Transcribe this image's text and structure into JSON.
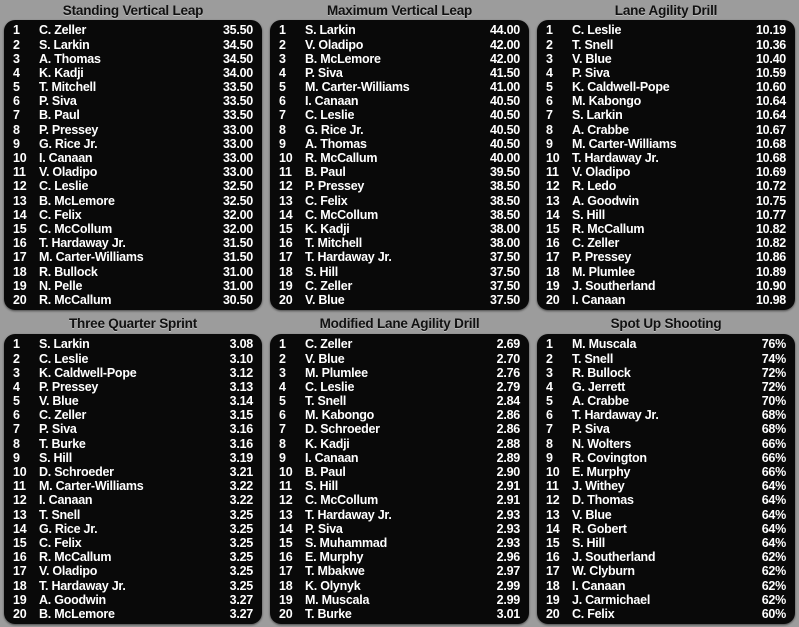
{
  "colors": {
    "background": "#9c9c9c",
    "panel": "#090909",
    "title_text": "#111111",
    "row_text": "#ffffff"
  },
  "panels": [
    {
      "title": "Standing Vertical Leap",
      "rows": [
        {
          "rank": "1",
          "name": "C. Zeller",
          "value": "35.50"
        },
        {
          "rank": "2",
          "name": "S. Larkin",
          "value": "34.50"
        },
        {
          "rank": "3",
          "name": "A. Thomas",
          "value": "34.50"
        },
        {
          "rank": "4",
          "name": "K. Kadji",
          "value": "34.00"
        },
        {
          "rank": "5",
          "name": "T. Mitchell",
          "value": "33.50"
        },
        {
          "rank": "6",
          "name": "P. Siva",
          "value": "33.50"
        },
        {
          "rank": "7",
          "name": "B. Paul",
          "value": "33.50"
        },
        {
          "rank": "8",
          "name": "P. Pressey",
          "value": "33.00"
        },
        {
          "rank": "9",
          "name": "G. Rice Jr.",
          "value": "33.00"
        },
        {
          "rank": "10",
          "name": "I. Canaan",
          "value": "33.00"
        },
        {
          "rank": "11",
          "name": "V. Oladipo",
          "value": "33.00"
        },
        {
          "rank": "12",
          "name": "C. Leslie",
          "value": "32.50"
        },
        {
          "rank": "13",
          "name": "B. McLemore",
          "value": "32.50"
        },
        {
          "rank": "14",
          "name": "C. Felix",
          "value": "32.00"
        },
        {
          "rank": "15",
          "name": "C. McCollum",
          "value": "32.00"
        },
        {
          "rank": "16",
          "name": "T. Hardaway Jr.",
          "value": "31.50"
        },
        {
          "rank": "17",
          "name": "M. Carter-Williams",
          "value": "31.50"
        },
        {
          "rank": "18",
          "name": "R. Bullock",
          "value": "31.00"
        },
        {
          "rank": "19",
          "name": "N. Pelle",
          "value": "31.00"
        },
        {
          "rank": "20",
          "name": "R. McCallum",
          "value": "30.50"
        }
      ]
    },
    {
      "title": "Maximum Vertical Leap",
      "rows": [
        {
          "rank": "1",
          "name": "S. Larkin",
          "value": "44.00"
        },
        {
          "rank": "2",
          "name": "V. Oladipo",
          "value": "42.00"
        },
        {
          "rank": "3",
          "name": "B. McLemore",
          "value": "42.00"
        },
        {
          "rank": "4",
          "name": "P. Siva",
          "value": "41.50"
        },
        {
          "rank": "5",
          "name": "M. Carter-Williams",
          "value": "41.00"
        },
        {
          "rank": "6",
          "name": "I. Canaan",
          "value": "40.50"
        },
        {
          "rank": "7",
          "name": "C. Leslie",
          "value": "40.50"
        },
        {
          "rank": "8",
          "name": "G. Rice Jr.",
          "value": "40.50"
        },
        {
          "rank": "9",
          "name": "A. Thomas",
          "value": "40.50"
        },
        {
          "rank": "10",
          "name": "R. McCallum",
          "value": "40.00"
        },
        {
          "rank": "11",
          "name": "B. Paul",
          "value": "39.50"
        },
        {
          "rank": "12",
          "name": "P. Pressey",
          "value": "38.50"
        },
        {
          "rank": "13",
          "name": "C. Felix",
          "value": "38.50"
        },
        {
          "rank": "14",
          "name": "C. McCollum",
          "value": "38.50"
        },
        {
          "rank": "15",
          "name": "K. Kadji",
          "value": "38.00"
        },
        {
          "rank": "16",
          "name": "T. Mitchell",
          "value": "38.00"
        },
        {
          "rank": "17",
          "name": "T. Hardaway Jr.",
          "value": "37.50"
        },
        {
          "rank": "18",
          "name": "S. Hill",
          "value": "37.50"
        },
        {
          "rank": "19",
          "name": "C. Zeller",
          "value": "37.50"
        },
        {
          "rank": "20",
          "name": "V. Blue",
          "value": "37.50"
        }
      ]
    },
    {
      "title": "Lane Agility Drill",
      "rows": [
        {
          "rank": "1",
          "name": "C. Leslie",
          "value": "10.19"
        },
        {
          "rank": "2",
          "name": "T. Snell",
          "value": "10.36"
        },
        {
          "rank": "3",
          "name": "V. Blue",
          "value": "10.40"
        },
        {
          "rank": "4",
          "name": "P. Siva",
          "value": "10.59"
        },
        {
          "rank": "5",
          "name": "K. Caldwell-Pope",
          "value": "10.60"
        },
        {
          "rank": "6",
          "name": "M. Kabongo",
          "value": "10.64"
        },
        {
          "rank": "7",
          "name": "S. Larkin",
          "value": "10.64"
        },
        {
          "rank": "8",
          "name": "A. Crabbe",
          "value": "10.67"
        },
        {
          "rank": "9",
          "name": "M. Carter-Williams",
          "value": "10.68"
        },
        {
          "rank": "10",
          "name": "T. Hardaway Jr.",
          "value": "10.68"
        },
        {
          "rank": "11",
          "name": "V. Oladipo",
          "value": "10.69"
        },
        {
          "rank": "12",
          "name": "R. Ledo",
          "value": "10.72"
        },
        {
          "rank": "13",
          "name": "A. Goodwin",
          "value": "10.75"
        },
        {
          "rank": "14",
          "name": "S. Hill",
          "value": "10.77"
        },
        {
          "rank": "15",
          "name": "R. McCallum",
          "value": "10.82"
        },
        {
          "rank": "16",
          "name": "C. Zeller",
          "value": "10.82"
        },
        {
          "rank": "17",
          "name": "P. Pressey",
          "value": "10.86"
        },
        {
          "rank": "18",
          "name": "M. Plumlee",
          "value": "10.89"
        },
        {
          "rank": "19",
          "name": "J. Southerland",
          "value": "10.90"
        },
        {
          "rank": "20",
          "name": "I. Canaan",
          "value": "10.98"
        }
      ]
    },
    {
      "title": "Three Quarter Sprint",
      "rows": [
        {
          "rank": "1",
          "name": "S. Larkin",
          "value": "3.08"
        },
        {
          "rank": "2",
          "name": "C. Leslie",
          "value": "3.10"
        },
        {
          "rank": "3",
          "name": "K. Caldwell-Pope",
          "value": "3.12"
        },
        {
          "rank": "4",
          "name": "P. Pressey",
          "value": "3.13"
        },
        {
          "rank": "5",
          "name": "V. Blue",
          "value": "3.14"
        },
        {
          "rank": "6",
          "name": "C. Zeller",
          "value": "3.15"
        },
        {
          "rank": "7",
          "name": "P. Siva",
          "value": "3.16"
        },
        {
          "rank": "8",
          "name": "T. Burke",
          "value": "3.16"
        },
        {
          "rank": "9",
          "name": "S. Hill",
          "value": "3.19"
        },
        {
          "rank": "10",
          "name": "D. Schroeder",
          "value": "3.21"
        },
        {
          "rank": "11",
          "name": "M. Carter-Williams",
          "value": "3.22"
        },
        {
          "rank": "12",
          "name": "I. Canaan",
          "value": "3.22"
        },
        {
          "rank": "13",
          "name": "T. Snell",
          "value": "3.25"
        },
        {
          "rank": "14",
          "name": "G. Rice Jr.",
          "value": "3.25"
        },
        {
          "rank": "15",
          "name": "C. Felix",
          "value": "3.25"
        },
        {
          "rank": "16",
          "name": "R. McCallum",
          "value": "3.25"
        },
        {
          "rank": "17",
          "name": "V. Oladipo",
          "value": "3.25"
        },
        {
          "rank": "18",
          "name": "T. Hardaway Jr.",
          "value": "3.25"
        },
        {
          "rank": "19",
          "name": "A. Goodwin",
          "value": "3.27"
        },
        {
          "rank": "20",
          "name": "B. McLemore",
          "value": "3.27"
        }
      ]
    },
    {
      "title": "Modified Lane Agility Drill",
      "rows": [
        {
          "rank": "1",
          "name": "C. Zeller",
          "value": "2.69"
        },
        {
          "rank": "2",
          "name": "V. Blue",
          "value": "2.70"
        },
        {
          "rank": "3",
          "name": "M. Plumlee",
          "value": "2.76"
        },
        {
          "rank": "4",
          "name": "C. Leslie",
          "value": "2.79"
        },
        {
          "rank": "5",
          "name": "T. Snell",
          "value": "2.84"
        },
        {
          "rank": "6",
          "name": "M. Kabongo",
          "value": "2.86"
        },
        {
          "rank": "7",
          "name": "D. Schroeder",
          "value": "2.86"
        },
        {
          "rank": "8",
          "name": "K. Kadji",
          "value": "2.88"
        },
        {
          "rank": "9",
          "name": "I. Canaan",
          "value": "2.89"
        },
        {
          "rank": "10",
          "name": "B. Paul",
          "value": "2.90"
        },
        {
          "rank": "11",
          "name": "S. Hill",
          "value": "2.91"
        },
        {
          "rank": "12",
          "name": "C. McCollum",
          "value": "2.91"
        },
        {
          "rank": "13",
          "name": "T. Hardaway Jr.",
          "value": "2.93"
        },
        {
          "rank": "14",
          "name": "P. Siva",
          "value": "2.93"
        },
        {
          "rank": "15",
          "name": "S. Muhammad",
          "value": "2.93"
        },
        {
          "rank": "16",
          "name": "E. Murphy",
          "value": "2.96"
        },
        {
          "rank": "17",
          "name": "T. Mbakwe",
          "value": "2.97"
        },
        {
          "rank": "18",
          "name": "K. Olynyk",
          "value": "2.99"
        },
        {
          "rank": "19",
          "name": "M. Muscala",
          "value": "2.99"
        },
        {
          "rank": "20",
          "name": "T. Burke",
          "value": "3.01"
        }
      ]
    },
    {
      "title": "Spot Up Shooting",
      "rows": [
        {
          "rank": "1",
          "name": "M. Muscala",
          "value": "76%"
        },
        {
          "rank": "2",
          "name": "T. Snell",
          "value": "74%"
        },
        {
          "rank": "3",
          "name": "R. Bullock",
          "value": "72%"
        },
        {
          "rank": "4",
          "name": "G. Jerrett",
          "value": "72%"
        },
        {
          "rank": "5",
          "name": "A. Crabbe",
          "value": "70%"
        },
        {
          "rank": "6",
          "name": "T. Hardaway Jr.",
          "value": "68%"
        },
        {
          "rank": "7",
          "name": "P. Siva",
          "value": "68%"
        },
        {
          "rank": "8",
          "name": "N. Wolters",
          "value": "66%"
        },
        {
          "rank": "9",
          "name": "R. Covington",
          "value": "66%"
        },
        {
          "rank": "10",
          "name": "E. Murphy",
          "value": "66%"
        },
        {
          "rank": "11",
          "name": "J. Withey",
          "value": "64%"
        },
        {
          "rank": "12",
          "name": "D. Thomas",
          "value": "64%"
        },
        {
          "rank": "13",
          "name": "V. Blue",
          "value": "64%"
        },
        {
          "rank": "14",
          "name": "R. Gobert",
          "value": "64%"
        },
        {
          "rank": "15",
          "name": "S. Hill",
          "value": "64%"
        },
        {
          "rank": "16",
          "name": "J. Southerland",
          "value": "62%"
        },
        {
          "rank": "17",
          "name": "W. Clyburn",
          "value": "62%"
        },
        {
          "rank": "18",
          "name": "I. Canaan",
          "value": "62%"
        },
        {
          "rank": "19",
          "name": "J. Carmichael",
          "value": "62%"
        },
        {
          "rank": "20",
          "name": "C. Felix",
          "value": "60%"
        }
      ]
    }
  ]
}
